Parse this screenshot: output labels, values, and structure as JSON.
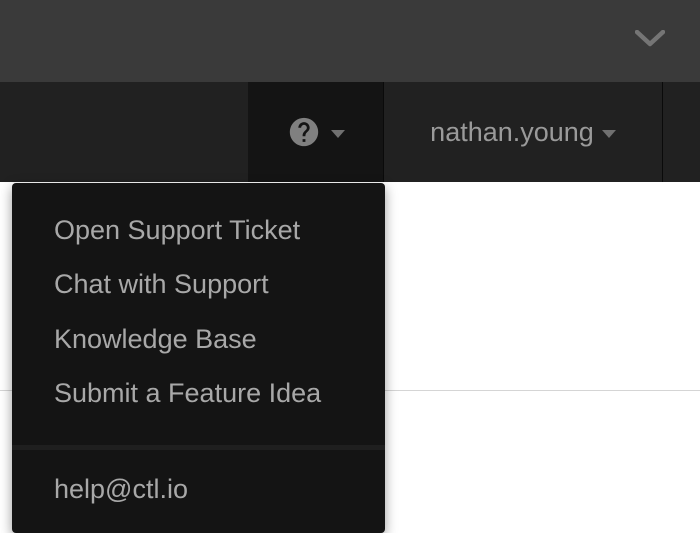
{
  "header": {
    "user_name": "nathan.young"
  },
  "help_menu": {
    "items": [
      "Open Support Ticket",
      "Chat with Support",
      "Knowledge Base",
      "Submit a Feature Idea"
    ],
    "email": "help@ctl.io"
  }
}
